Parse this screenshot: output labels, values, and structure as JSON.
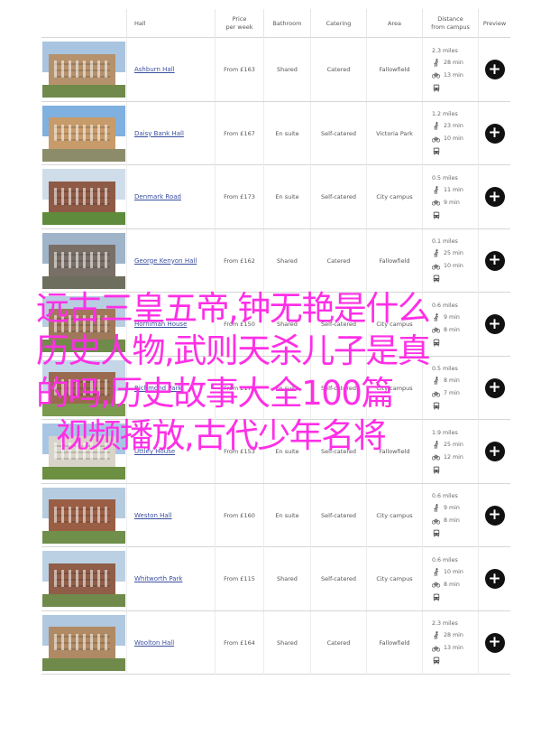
{
  "header": {
    "hall": "Hall",
    "price": "Price",
    "price_sub": "per week",
    "bathroom": "Bathroom",
    "catering": "Catering",
    "area": "Area",
    "distance": "Distance",
    "distance_sub": "from campus",
    "preview": "Preview"
  },
  "rows": [
    {
      "name": "Ashburn Hall",
      "price": "From £163",
      "bathroom": "Shared",
      "catering": "Catered",
      "area": "Fallowfield",
      "miles": "2.3 miles",
      "walk": "28 min",
      "bus": "13 min",
      "sky": "#a9c4e0",
      "building": "#b5916c",
      "grass": "#6f8a4a"
    },
    {
      "name": "Daisy Bank Hall",
      "price": "From £167",
      "bathroom": "En suite",
      "catering": "Self-catered",
      "area": "Victoria Park",
      "miles": "1.2 miles",
      "walk": "23 min",
      "bus": "10 min",
      "sky": "#7fb0e0",
      "building": "#c79b6a",
      "grass": "#8c8c6a"
    },
    {
      "name": "Denmark Road",
      "price": "From £173",
      "bathroom": "En suite",
      "catering": "Self-catered",
      "area": "City campus",
      "miles": "0.5 miles",
      "walk": "11 min",
      "bus": "9 min",
      "sky": "#cfdcea",
      "building": "#8e5a46",
      "grass": "#5f8c3c"
    },
    {
      "name": "George Kenyon Hall",
      "price": "From £162",
      "bathroom": "Shared",
      "catering": "Catered",
      "area": "Fallowfield",
      "miles": "0.1 miles",
      "walk": "25 min",
      "bus": "10 min",
      "sky": "#9fb3c9",
      "building": "#7a6f66",
      "grass": "#6e6e5e"
    },
    {
      "name": "Horniman House",
      "price": "From £150",
      "bathroom": "Shared",
      "catering": "Self-catered",
      "area": "City campus",
      "miles": "0.6 miles",
      "walk": "9 min",
      "bus": "8 min",
      "sky": "#b8cde2",
      "building": "#a0785a",
      "grass": "#6f8a4a"
    },
    {
      "name": "Richmond Park",
      "price": "From £170",
      "bathroom": "En suite",
      "catering": "Self-catered",
      "area": "City campus",
      "miles": "0.5 miles",
      "walk": "8 min",
      "bus": "7 min",
      "sky": "#c4d6e8",
      "building": "#9a6a4e",
      "grass": "#7a9a4e"
    },
    {
      "name": "Uttley House",
      "price": "From £153",
      "bathroom": "En suite",
      "catering": "Self-catered",
      "area": "Fallowfield",
      "miles": "1.9 miles",
      "walk": "25 min",
      "bus": "12 min",
      "sky": "#a8c6e4",
      "building": "#d9d4c8",
      "grass": "#6c8f42"
    },
    {
      "name": "Weston Hall",
      "price": "From £160",
      "bathroom": "En suite",
      "catering": "Self-catered",
      "area": "City campus",
      "miles": "0.6 miles",
      "walk": "9 min",
      "bus": "8 min",
      "sky": "#b5cbe0",
      "building": "#9a5e44",
      "grass": "#6f8f4a"
    },
    {
      "name": "Whitworth Park",
      "price": "From £115",
      "bathroom": "Shared",
      "catering": "Self-catered",
      "area": "City campus",
      "miles": "0.6 miles",
      "walk": "10 min",
      "bus": "8 min",
      "sky": "#bcd0e4",
      "building": "#8f5d48",
      "grass": "#6f8a4a"
    },
    {
      "name": "Woolton Hall",
      "price": "From £164",
      "bathroom": "Shared",
      "catering": "Catered",
      "area": "Fallowfield",
      "miles": "2.3 miles",
      "walk": "28 min",
      "bus": "13 min",
      "sky": "#b0c8e0",
      "building": "#b08a64",
      "grass": "#6f8a4a"
    }
  ],
  "overlay": {
    "line1": "远古三皇五帝,钟无艳是什么",
    "line2": "历史人物,武则天杀儿子是真",
    "line3": "的吗,历史故事大全100篇",
    "line4": "视频播放,古代少年名将"
  },
  "colors": {
    "overlay_text": "#ff2fe6",
    "link": "#3a4fa0"
  },
  "icons": {
    "walk": "walking-person-icon",
    "bike": "bicycle-icon",
    "bus": "bus-icon",
    "preview": "plus-circle-icon"
  }
}
